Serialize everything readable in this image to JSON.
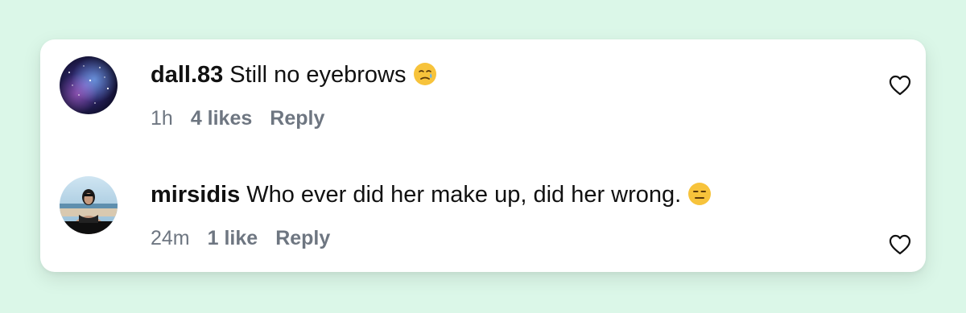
{
  "comments": [
    {
      "username": "dall.83",
      "text": "Still no eyebrows",
      "emoji_icon": "crying-face-icon",
      "time": "1h",
      "likes": "4 likes",
      "reply_label": "Reply",
      "like_icon": "heart-outline-icon"
    },
    {
      "username": "mirsidis",
      "text": "Who ever did her make up, did her wrong.",
      "emoji_icon": "expressionless-face-icon",
      "time": "24m",
      "likes": "1 like",
      "reply_label": "Reply",
      "like_icon": "heart-outline-icon"
    }
  ],
  "colors": {
    "page_background": "#dbf7e8",
    "card_background": "#ffffff",
    "text_primary": "#111111",
    "text_secondary": "#6e7681"
  }
}
